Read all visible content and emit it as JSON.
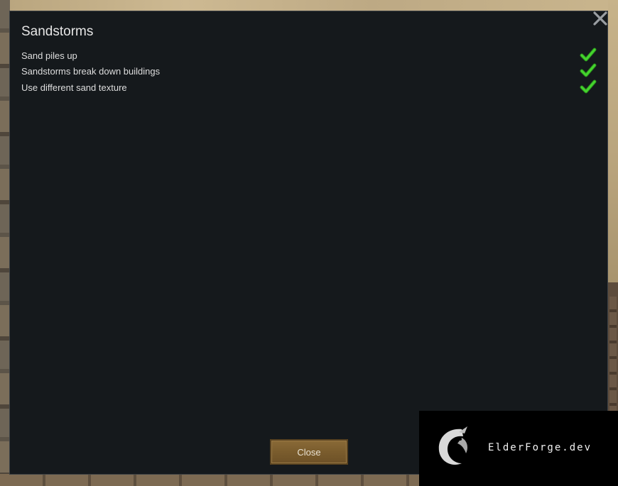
{
  "dialog": {
    "title": "Sandstorms",
    "options": [
      {
        "label": "Sand piles up",
        "checked": true
      },
      {
        "label": "Sandstorms break down buildings",
        "checked": true
      },
      {
        "label": "Use different sand texture",
        "checked": true
      }
    ],
    "close_label": "Close",
    "check_color": "#3fcf2a",
    "close_icon": "close-icon"
  },
  "watermark": {
    "text": "ElderForge.dev",
    "icon": "dragon-logo-icon"
  }
}
